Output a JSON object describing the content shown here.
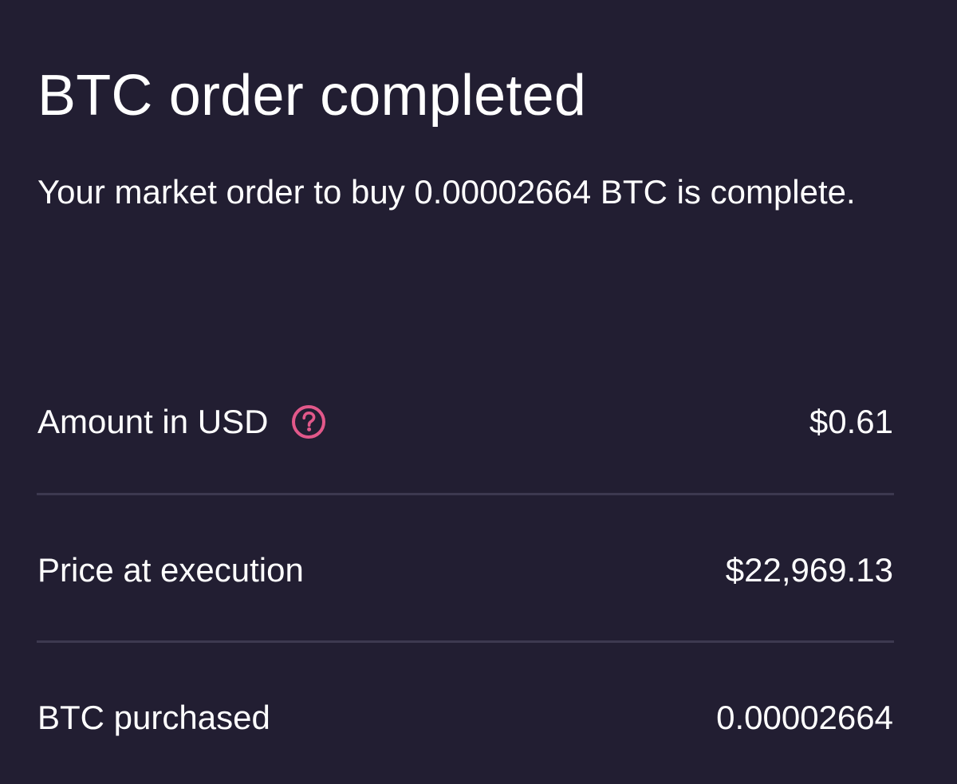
{
  "order": {
    "title": "BTC order completed",
    "description": "Your market order to buy 0.00002664 BTC is complete."
  },
  "details": [
    {
      "label": "Amount in USD",
      "value": "$0.61",
      "has_help_icon": true,
      "help_icon": "question-circle-icon"
    },
    {
      "label": "Price at execution",
      "value": "$22,969.13",
      "has_help_icon": false
    },
    {
      "label": "BTC purchased",
      "value": "0.00002664",
      "has_help_icon": false
    }
  ],
  "colors": {
    "background": "#221E32",
    "text": "#FFFFFF",
    "divider": "#3D3950",
    "accent": "#E2588A"
  }
}
